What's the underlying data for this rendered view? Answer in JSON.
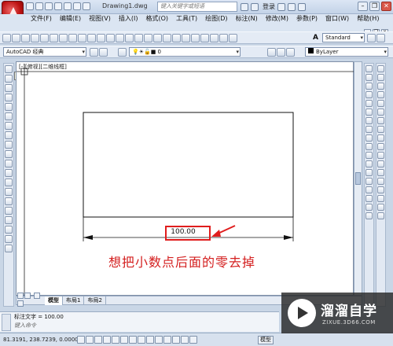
{
  "title": {
    "document": "Drawing1.dwg",
    "search_placeholder": "键入关键字或短语",
    "login": "登录"
  },
  "menu": {
    "items": [
      "文件(F)",
      "编辑(E)",
      "视图(V)",
      "插入(I)",
      "格式(O)",
      "工具(T)",
      "绘图(D)",
      "标注(N)",
      "修改(M)",
      "参数(P)",
      "窗口(W)",
      "帮助(H)"
    ]
  },
  "toolbars": {
    "workspace": "AutoCAD 经典",
    "layer": "0",
    "text_style": "Standard",
    "color": "ByLayer"
  },
  "viewport": {
    "label": "[-][俯视][二维线框]",
    "tooltip": "绘图"
  },
  "drawing": {
    "dimension_value": "100.00",
    "caption": "想把小数点后面的零去掉"
  },
  "layout_tabs": [
    "模型",
    "布局1",
    "布局2"
  ],
  "command": {
    "history": "标注文字 = 100.00",
    "prompt": "键入命令"
  },
  "status": {
    "coords": "81.3191, 238.7239, 0.0000",
    "model": "模型"
  },
  "watermark": {
    "title": "溜溜自学",
    "url": "ZIXUE.3D66.COM"
  },
  "colors": {
    "annotation_red": "#e01d1d",
    "ribbon_blue": "#dbe5f2"
  }
}
